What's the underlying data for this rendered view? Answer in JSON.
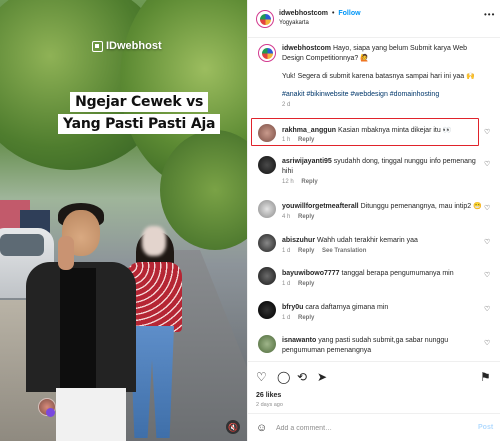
{
  "media": {
    "watermark": "IDwebhost",
    "caption_lines": [
      "Ngejar Cewek vs",
      "Yang Pasti Pasti Aja"
    ],
    "mute_icon": "mute-icon"
  },
  "header": {
    "username": "idwebhostcom",
    "separator": "•",
    "follow_label": "Follow",
    "location": "Yogyakarta",
    "more_icon": "more-icon"
  },
  "post_caption": {
    "username": "idwebhostcom",
    "line1": "Hayo, siapa yang belum Submit karya Web Design Competitionnya? 🙋",
    "line2": "Yuk! Segera di submit karena batasnya sampai hari ini yaa 🙌",
    "hashtags": "#anakit #bikinwebsite #webdesign #domainhosting",
    "time": "2 d"
  },
  "comments": [
    {
      "username": "rakhma_anggun",
      "text": "Kasian mbaknya minta dikejar itu 👀",
      "time": "1 h",
      "reply": "Reply",
      "extra": ""
    },
    {
      "username": "asriwijayanti95",
      "text": "syudahh dong, tinggal nunggu info pemenang hihi",
      "time": "12 h",
      "reply": "Reply",
      "extra": ""
    },
    {
      "username": "youwillforgetmeafterall",
      "text": "Ditunggu pemenangnya, mau intip2 😁",
      "time": "4 h",
      "reply": "Reply",
      "extra": ""
    },
    {
      "username": "abiszuhur",
      "text": "Wahh udah terakhir kemarin yaa",
      "time": "1 d",
      "reply": "Reply",
      "extra": "See Translation"
    },
    {
      "username": "bayuwibowo7777",
      "text": "tanggal berapa pengumumanya min",
      "time": "1 d",
      "reply": "Reply",
      "extra": ""
    },
    {
      "username": "bfry0u",
      "text": "cara daftarnya gimana min",
      "time": "1 d",
      "reply": "Reply",
      "extra": ""
    },
    {
      "username": "isnawanto",
      "text": "yang pasti sudah submit,ga sabar nunggu pengumuman pemenangnya",
      "time": "1 d",
      "reply": "Reply",
      "extra": ""
    }
  ],
  "actions": {
    "likes": "26 likes",
    "posted": "2 days ago"
  },
  "add_comment": {
    "placeholder": "Add a comment…",
    "post_label": "Post"
  },
  "colors": {
    "link_blue": "#0095f6",
    "highlight_red": "#e0232b",
    "muted_text": "#8e8e8e"
  }
}
